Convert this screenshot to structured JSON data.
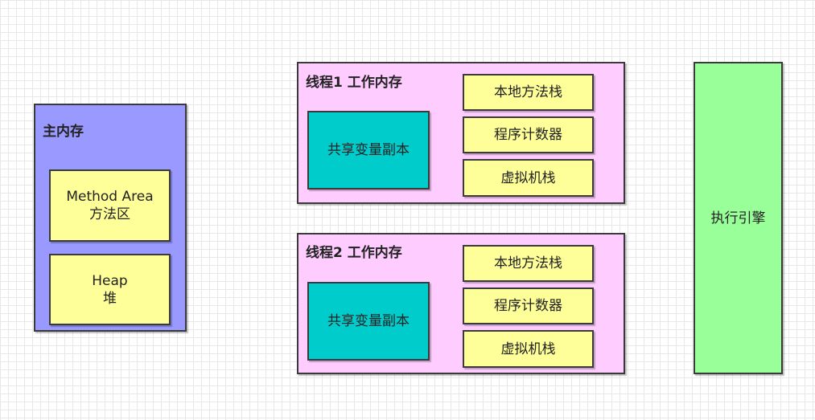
{
  "colors": {
    "main_memory_bg": "#9999ff",
    "area_box_bg": "#ffff99",
    "thread_bg": "#ffccff",
    "shared_copy_bg": "#00cccc",
    "engine_bg": "#99ff99",
    "border": "#3a3a3a"
  },
  "main_memory": {
    "title": "主内存",
    "method_area": {
      "line1": "Method Area",
      "line2": "方法区"
    },
    "heap": {
      "line1": "Heap",
      "line2": "堆"
    }
  },
  "thread1": {
    "title": "线程1 工作内存",
    "shared_copy": "共享变量副本",
    "native_stack": "本地方法栈",
    "pc_register": "程序计数器",
    "vm_stack": "虚拟机栈"
  },
  "thread2": {
    "title": "线程2 工作内存",
    "shared_copy": "共享变量副本",
    "native_stack": "本地方法栈",
    "pc_register": "程序计数器",
    "vm_stack": "虚拟机栈"
  },
  "engine": {
    "label": "执行引擎"
  }
}
